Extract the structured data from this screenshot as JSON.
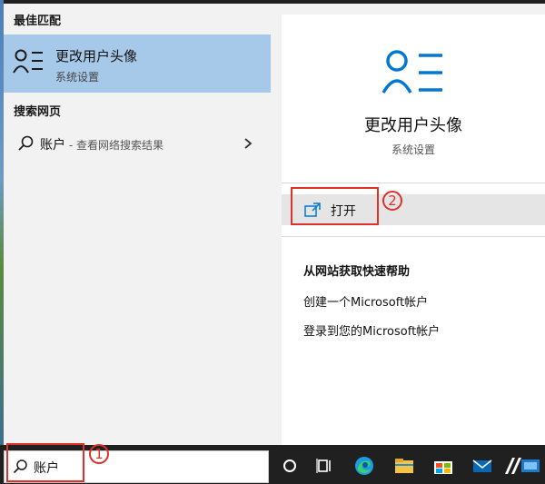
{
  "left": {
    "best_match_header": "最佳匹配",
    "best_match": {
      "title": "更改用户头像",
      "subtitle": "系统设置"
    },
    "web_header": "搜索网页",
    "web_result": {
      "query": "账户",
      "hint": " - 查看网络搜索结果"
    }
  },
  "preview": {
    "title": "更改用户头像",
    "subtitle": "系统设置",
    "open_label": "打开",
    "help_title": "从网站获取快速帮助",
    "links": [
      "创建一个Microsoft帐户",
      "登录到您的Microsoft帐户"
    ]
  },
  "search_box": {
    "value": "账户"
  },
  "annotations": {
    "step1": "1",
    "step2": "2"
  },
  "taskbar": {
    "icons": [
      "cortana-icon",
      "task-view-icon",
      "edge-icon",
      "file-explorer-icon",
      "store-icon",
      "mail-icon",
      "app-icon",
      "settings-app-icon"
    ]
  },
  "colors": {
    "accent": "#0078d4",
    "selection": "#a7c9e9",
    "annotation": "#e0302a"
  }
}
